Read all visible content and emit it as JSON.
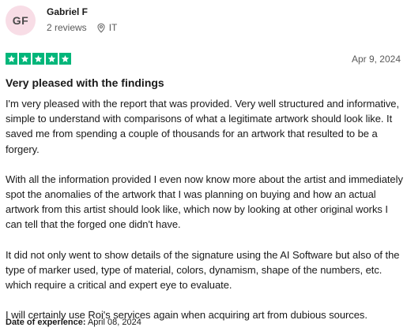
{
  "reviewer": {
    "initials": "GF",
    "name": "Gabriel F",
    "reviews_count": "2 reviews",
    "country": "IT",
    "avatar_bg": "#f8dde6",
    "avatar_fg": "#4a4a4a"
  },
  "rating": {
    "stars": 5,
    "max": 5,
    "color": "#00b67a",
    "icon": "star-icon"
  },
  "review": {
    "date": "Apr 9, 2024",
    "title": "Very pleased with the findings",
    "paragraphs": [
      "I'm very pleased with the report that was provided. Very well structured and informative, simple to understand with comparisons of what a legitimate artwork should look like. It saved me from spending a couple of thousands for an artwork that resulted to be a forgery.",
      "With all the information provided I even now know more about the artist and immediately spot the anomalies of the artwork that I was planning on buying and how an actual artwork from this artist should look like, which now by looking at other original works I can tell that the forged one didn't have.",
      "It did not only went to show details of the signature using the AI Software but also of the type of marker used, type of material, colors, dynamism, shape of the numbers, etc. which require a critical and expert eye to evaluate.",
      "I will certainly use Roi's services again when acquiring art from dubious sources."
    ],
    "experience_label": "Date of experience:",
    "experience_date": "April 08, 2024"
  }
}
